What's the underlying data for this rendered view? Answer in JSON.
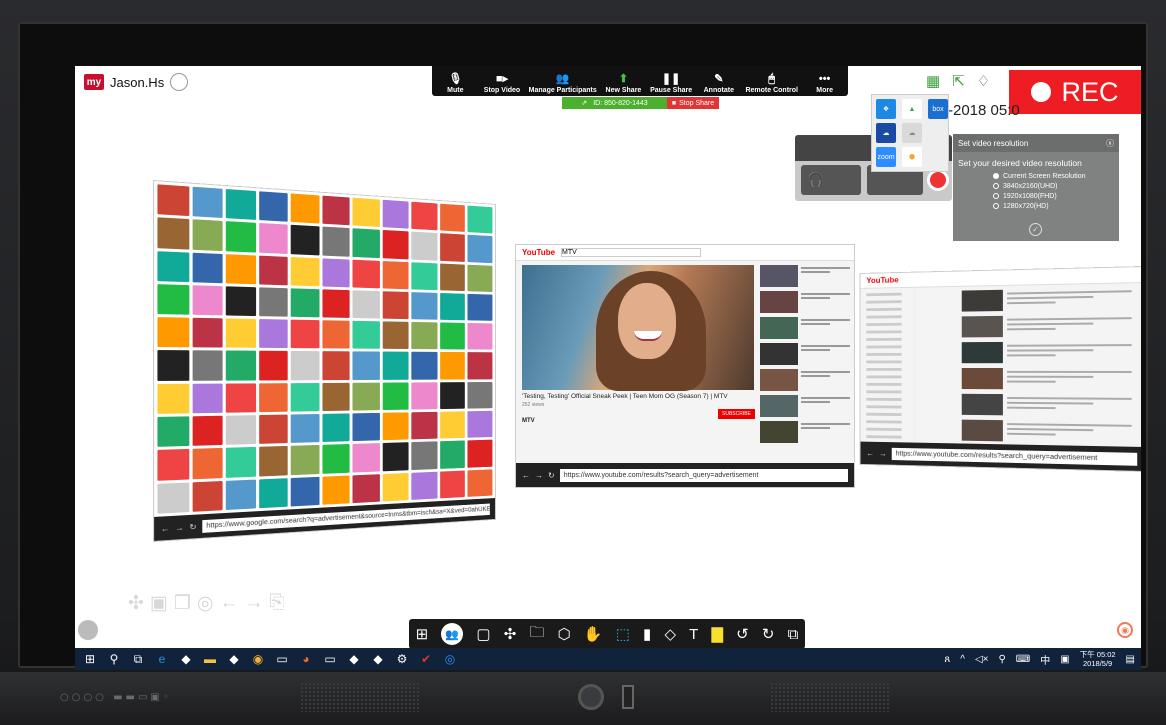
{
  "user": {
    "badge": "my",
    "name": "Jason.Hs"
  },
  "zoom_toolbar": [
    {
      "label": "Mute",
      "icon": "microphone-icon"
    },
    {
      "label": "Stop Video",
      "icon": "video-camera-icon"
    },
    {
      "label": "Manage Participants",
      "icon": "participants-icon"
    },
    {
      "label": "New Share",
      "icon": "share-screen-icon"
    },
    {
      "label": "Pause Share",
      "icon": "pause-icon"
    },
    {
      "label": "Annotate",
      "icon": "pen-icon"
    },
    {
      "label": "Remote Control",
      "icon": "mouse-icon"
    },
    {
      "label": "More",
      "icon": "ellipsis-icon"
    }
  ],
  "share_status": {
    "id_text": "ID: 850-820-1443",
    "stop_label": "Stop Share"
  },
  "rec_label": "REC",
  "date_text": "-2018 05:0",
  "cloud_services": [
    {
      "label": "",
      "icon": "dropbox-icon",
      "color": "#1e88e5"
    },
    {
      "label": "",
      "icon": "google-drive-icon",
      "color": "#ffffff"
    },
    {
      "label": "box",
      "icon": "box-icon",
      "color": "#1a6fd1"
    },
    {
      "label": "",
      "icon": "onedrive-icon",
      "color": "#1b4aa5"
    },
    {
      "label": "",
      "icon": "cloud-icon",
      "color": "#d9d9d9"
    },
    {
      "label": "",
      "icon": "blank-icon",
      "color": "#eeeeee"
    },
    {
      "label": "zoom",
      "icon": "zoom-icon",
      "color": "#2d8cff"
    },
    {
      "label": "",
      "icon": "settings-hex-icon",
      "color": "#f5a623"
    }
  ],
  "video_resolution": {
    "title": "Set video resolution",
    "subtitle": "Set your desired video resolution",
    "options": [
      {
        "label": "Current Screen Resolution",
        "selected": true
      },
      {
        "label": "3840x2160(UHD)",
        "selected": false
      },
      {
        "label": "1920x1080(FHD)",
        "selected": false
      },
      {
        "label": "1280x720(HD)",
        "selected": false
      }
    ]
  },
  "browser_windows": {
    "google_url": "https://www.google.com/search?q=advertisement&source=lnms&tbm=isch&sa=X&ved=0ahUKEwiM",
    "youtube": {
      "brand": "YouTube",
      "search_value": "MTV",
      "title": "'Testing, Testing' Official Sneak Peek | Teen Mom OG (Season 7) | MTV",
      "views": "252 views",
      "channel": "MTV",
      "subscribe": "SUBSCRIBE",
      "url": "https://www.youtube.com/results?search_query=advertisement"
    },
    "youtube_results_url": "https://www.youtube.com/results?search_query=advertisement"
  },
  "annotation_tools": [
    "windows-icon",
    "participants-icon",
    "screenshot-icon",
    "move-icon",
    "folder-icon",
    "box-icon",
    "hand-icon",
    "select-icon",
    "marker-icon",
    "eraser-icon",
    "text-icon",
    "sticky-note-icon",
    "undo-icon",
    "redo-icon",
    "page-icon"
  ],
  "taskbar": {
    "apps": [
      "windows-start-icon",
      "search-icon",
      "task-view-icon",
      "edge-icon",
      "app-icon",
      "file-explorer-icon",
      "app-icon",
      "chrome-icon",
      "terminal-icon",
      "firefox-icon",
      "terminal-icon",
      "app-icon",
      "app-icon",
      "settings-icon",
      "check-icon",
      "zoom-icon"
    ],
    "time": "下午 05:02",
    "date": "2018/5/9",
    "ime": "中"
  },
  "colors": {
    "rec_red": "#ee1d23",
    "share_green": "#4caf2e",
    "stop_red": "#e23434",
    "taskbar": "#10233a"
  }
}
